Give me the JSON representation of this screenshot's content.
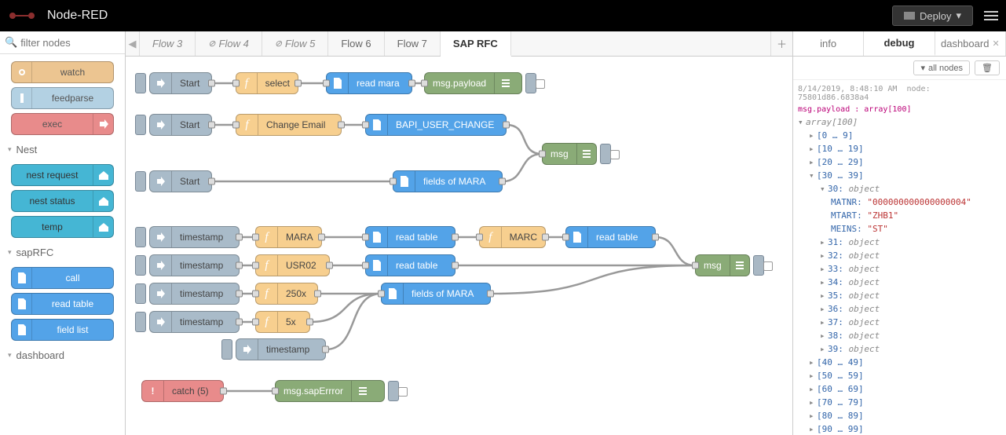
{
  "header": {
    "brand": "Node-RED",
    "deploy_label": "Deploy"
  },
  "palette": {
    "search_placeholder": "filter nodes",
    "top_nodes": [
      {
        "name": "watch",
        "label": "watch",
        "color": "c-watch",
        "icon": "eye"
      },
      {
        "name": "feedparse",
        "label": "feedparse",
        "color": "c-feed",
        "icon": "feed"
      },
      {
        "name": "exec",
        "label": "exec",
        "color": "c-exec",
        "icon": "arrow",
        "right": true
      }
    ],
    "categories": [
      {
        "name": "Nest",
        "items": [
          {
            "name": "nest-request",
            "label": "nest request",
            "color": "c-nest",
            "icon": "home",
            "right": true
          },
          {
            "name": "nest-status",
            "label": "nest status",
            "color": "c-nest",
            "icon": "home",
            "right": true
          },
          {
            "name": "temp",
            "label": "temp",
            "color": "c-nest",
            "icon": "home",
            "right": true
          }
        ]
      },
      {
        "name": "sapRFC",
        "items": [
          {
            "name": "call",
            "label": "call",
            "color": "c-sap",
            "icon": "doc"
          },
          {
            "name": "read-table",
            "label": "read table",
            "color": "c-sap",
            "icon": "doc"
          },
          {
            "name": "field-list",
            "label": "field list",
            "color": "c-sap",
            "icon": "doc"
          }
        ]
      },
      {
        "name": "dashboard",
        "items": []
      }
    ]
  },
  "tabs": [
    {
      "label": "Flow 3",
      "state": "italic"
    },
    {
      "label": "Flow 4",
      "state": "disabled"
    },
    {
      "label": "Flow 5",
      "state": "disabled"
    },
    {
      "label": "Flow 6",
      "state": "normal"
    },
    {
      "label": "Flow 7",
      "state": "normal"
    },
    {
      "label": "SAP RFC",
      "state": "active"
    }
  ],
  "nodes": {
    "inj1": "Start",
    "fn1": "select",
    "sap1": "read mara",
    "dbg1": "msg.payload",
    "inj2": "Start",
    "fn2": "Change Email",
    "sap2": "BAPI_USER_CHANGE",
    "dbg2": "msg",
    "inj3": "Start",
    "sap3": "fields of MARA",
    "inj4": "timestamp",
    "fn4": "MARA",
    "sap4": "read table",
    "fn4b": "MARC",
    "sap4b": "read table",
    "inj5": "timestamp",
    "fn5": "USR02",
    "sap5": "read table",
    "dbg5": "msg",
    "inj6": "timestamp",
    "fn6": "250x",
    "sap6": "fields of MARA",
    "inj7": "timestamp",
    "fn7": "5x",
    "inj8": "timestamp",
    "catch": "catch (5)",
    "dbg_err": "msg.sapErrror"
  },
  "sidebar": {
    "tabs": [
      {
        "label": "info"
      },
      {
        "label": "debug",
        "active": true
      },
      {
        "label": "dashboard",
        "close": true
      }
    ],
    "filter_btn": "all nodes",
    "msg_time": "8/14/2019, 8:48:10 AM",
    "msg_node": "node: 75801d86.6838a4",
    "msg_path": "msg.payload : array[100]",
    "root": "array[100]",
    "ranges": [
      "[0 … 9]",
      "[10 … 19]",
      "[20 … 29]",
      "[30 … 39]"
    ],
    "open_idx": "30",
    "open_fields": [
      {
        "k": "MATNR",
        "v": "\"000000000000000004\""
      },
      {
        "k": "MTART",
        "v": "\"ZHB1\""
      },
      {
        "k": "MEINS",
        "v": "\"ST\""
      }
    ],
    "siblings": [
      "31",
      "32",
      "33",
      "34",
      "35",
      "36",
      "37",
      "38",
      "39"
    ],
    "tail_ranges": [
      "[40 … 49]",
      "[50 … 59]",
      "[60 … 69]",
      "[70 … 79]",
      "[80 … 89]",
      "[90 … 99]"
    ]
  }
}
